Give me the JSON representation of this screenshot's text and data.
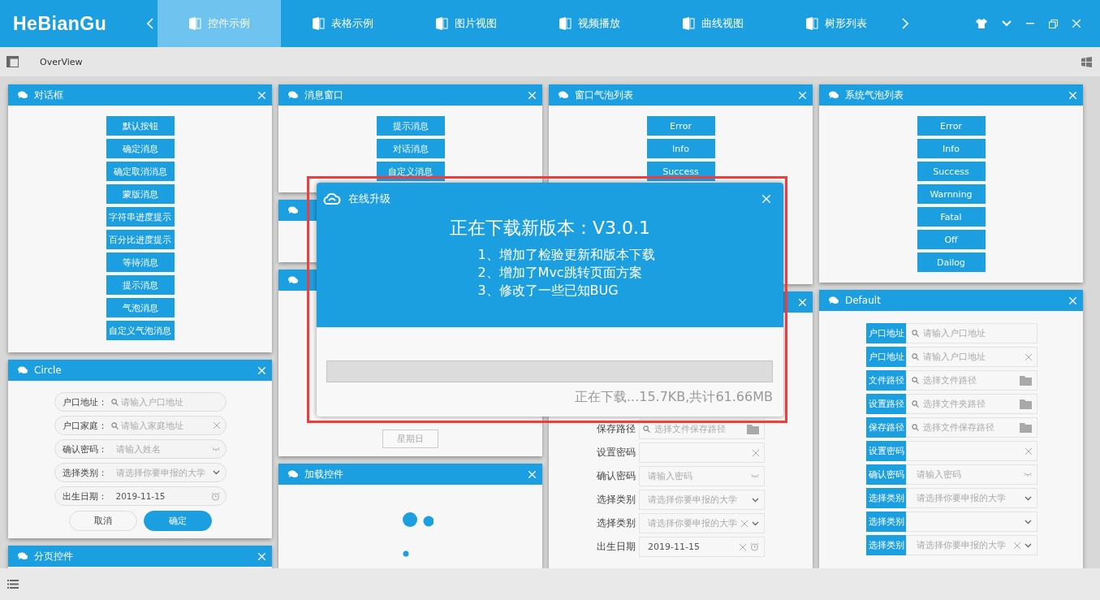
{
  "app": {
    "logo": "HeBianGu"
  },
  "tabs": [
    {
      "label": "控件示例",
      "selected": true
    },
    {
      "label": "表格示例",
      "selected": false
    },
    {
      "label": "图片视图",
      "selected": false
    },
    {
      "label": "视频播放",
      "selected": false
    },
    {
      "label": "曲线视图",
      "selected": false
    },
    {
      "label": "树形列表",
      "selected": false
    }
  ],
  "toolbar": {
    "title": "OverView"
  },
  "columns": [
    [
      {
        "title": "对话框",
        "kind": "buttons",
        "buttons": [
          "默认按钮",
          "确定消息",
          "确定取消消息",
          "蒙版消息",
          "字符串进度提示",
          "百分比进度提示",
          "等待消息",
          "提示消息",
          "气泡消息",
          "自定义气泡消息"
        ]
      },
      {
        "title": "Circle",
        "kind": "circle-form",
        "fields": [
          {
            "label": "户口地址：",
            "kind": "search",
            "placeholder": "请输入户口地址"
          },
          {
            "label": "户口家庭：",
            "kind": "search-clear",
            "placeholder": "请输入家庭地址"
          },
          {
            "label": "确认密码：",
            "kind": "password-confirm",
            "placeholder": "请输入姓名"
          },
          {
            "label": "选择类别：",
            "kind": "select",
            "placeholder": "请选择你要申报的大学"
          },
          {
            "label": "出生日期：",
            "kind": "date",
            "value": "2019-11-15"
          }
        ],
        "actions": [
          {
            "label": "取消",
            "primary": false
          },
          {
            "label": "确定",
            "primary": true
          }
        ]
      },
      {
        "title": "分页控件",
        "kind": "empty"
      }
    ],
    [
      {
        "title": "消息窗口",
        "kind": "buttons",
        "buttons": [
          "提示消息",
          "对话消息",
          "自定义消息"
        ]
      },
      {
        "kind": "empty"
      },
      {
        "kind": "radio-buttons",
        "buttons": [
          "星期日"
        ]
      },
      {
        "title": "加载控件",
        "kind": "loader"
      }
    ],
    [
      {
        "title": "窗口气泡列表",
        "kind": "buttons",
        "buttons": [
          "Error",
          "Info",
          "Success"
        ]
      },
      {
        "kind": "label-form",
        "fields": [
          {
            "label": "保存路径",
            "kind": "path",
            "placeholder": "选择文件保存路径"
          },
          {
            "label": "设置密码",
            "kind": "password"
          },
          {
            "label": "确认密码",
            "kind": "password-confirm",
            "placeholder": "请输入密码"
          },
          {
            "label": "选择类别",
            "kind": "select",
            "placeholder": "请选择你要申报的大学"
          },
          {
            "label": "选择类别",
            "kind": "select-clear",
            "placeholder": "请选择你要申报的大学"
          },
          {
            "label": "出生日期",
            "kind": "date-clear",
            "value": "2019-11-15"
          }
        ]
      }
    ],
    [
      {
        "title": "系统气泡列表",
        "kind": "buttons",
        "buttons": [
          "Error",
          "Info",
          "Success",
          "Warnning",
          "Fatal",
          "Off",
          "Dailog"
        ]
      },
      {
        "title": "Default",
        "kind": "block-form",
        "fields": [
          {
            "label": "户口地址",
            "kind": "search",
            "placeholder": "请输入户口地址"
          },
          {
            "label": "户口地址",
            "kind": "search-clear",
            "placeholder": "请输入户口地址"
          },
          {
            "label": "文件路径",
            "kind": "path",
            "placeholder": "选择文件路径"
          },
          {
            "label": "设置路径",
            "kind": "path",
            "placeholder": "选择文件夹路径"
          },
          {
            "label": "保存路径",
            "kind": "path",
            "placeholder": "选择文件保存路径"
          },
          {
            "label": "设置密码",
            "kind": "password"
          },
          {
            "label": "确认密码",
            "kind": "password-confirm",
            "placeholder": "请输入密码"
          },
          {
            "label": "选择类别",
            "kind": "select",
            "placeholder": "请选择你要申报的大学"
          },
          {
            "label": "选择类别",
            "kind": "select"
          },
          {
            "label": "选择类别",
            "kind": "select-clear",
            "placeholder": "请选择你要申报的大学"
          }
        ]
      }
    ]
  ],
  "dialog": {
    "title": "在线升级",
    "heading": "正在下载新版本：V3.0.1",
    "notes": [
      "1、增加了检验更新和版本下载",
      "2、增加了Mvc跳转页面方案",
      "3、修改了一些已知BUG"
    ],
    "progress": {
      "level": 0
    },
    "status": "正在下载...15.7KB,共计61.66MB"
  }
}
